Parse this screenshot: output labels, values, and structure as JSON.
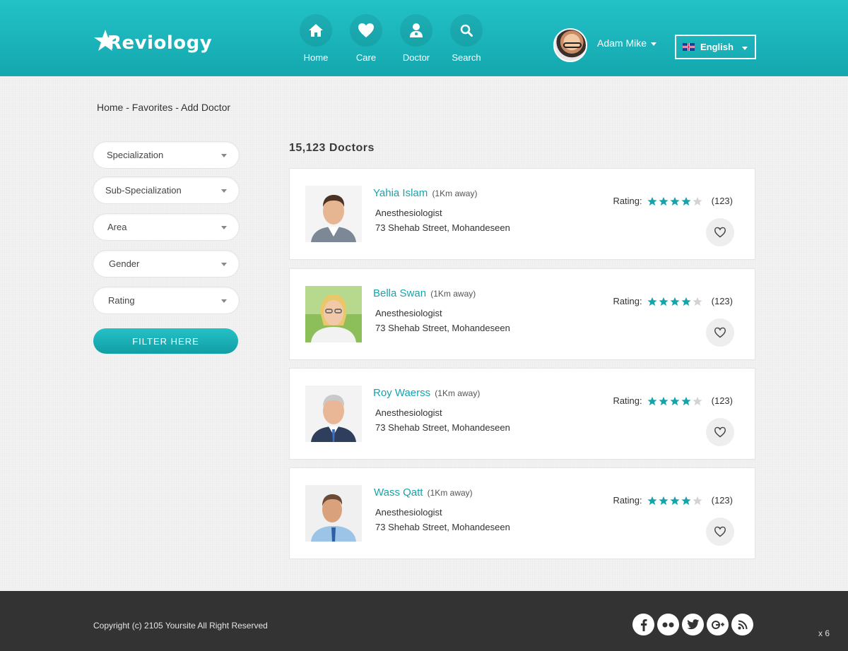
{
  "brand": {
    "name": "Reviology"
  },
  "nav": [
    {
      "label": "Home",
      "icon": "home-icon"
    },
    {
      "label": "Care",
      "icon": "heart-icon"
    },
    {
      "label": "Doctor",
      "icon": "doctor-icon"
    },
    {
      "label": "Search",
      "icon": "search-icon"
    }
  ],
  "user": {
    "name": "Adam Mike"
  },
  "language": {
    "selected": "English"
  },
  "breadcrumb": "Home - Favorites - Add Doctor",
  "filters": [
    {
      "label": "Specialization"
    },
    {
      "label": "Sub-Specialization"
    },
    {
      "label": "Area"
    },
    {
      "label": "Gender"
    },
    {
      "label": "Rating"
    }
  ],
  "filter_button": "FILTER HERE",
  "results": {
    "count_label": "15,123  Doctors",
    "rating_label": "Rating:",
    "doctors": [
      {
        "name": "Yahia Islam",
        "distance": "(1Km away)",
        "specialty": "Anesthesiologist",
        "address": "73 Shehab Street, Mohandeseen",
        "rating": 4,
        "rating_max": 5,
        "reviews": "(123)"
      },
      {
        "name": "Bella Swan",
        "distance": "(1Km away)",
        "specialty": "Anesthesiologist",
        "address": "73 Shehab Street, Mohandeseen",
        "rating": 4,
        "rating_max": 5,
        "reviews": "(123)"
      },
      {
        "name": "Roy Waerss",
        "distance": "(1Km away)",
        "specialty": "Anesthesiologist",
        "address": "73 Shehab Street, Mohandeseen",
        "rating": 4,
        "rating_max": 5,
        "reviews": "(123)"
      },
      {
        "name": "Wass Qatt",
        "distance": "(1Km away)",
        "specialty": "Anesthesiologist",
        "address": "73 Shehab Street, Mohandeseen",
        "rating": 4,
        "rating_max": 5,
        "reviews": "(123)"
      }
    ]
  },
  "footer": {
    "copyright": "Copyright (c) 2105 Yoursite All Right Reserved",
    "socials": [
      "facebook-icon",
      "flickr-icon",
      "twitter-icon",
      "google-plus-icon",
      "rss-icon"
    ],
    "corner_text": "x 6"
  },
  "colors": {
    "accent": "#16a4ab",
    "header": "#1bb5bb",
    "footer": "#333333"
  }
}
